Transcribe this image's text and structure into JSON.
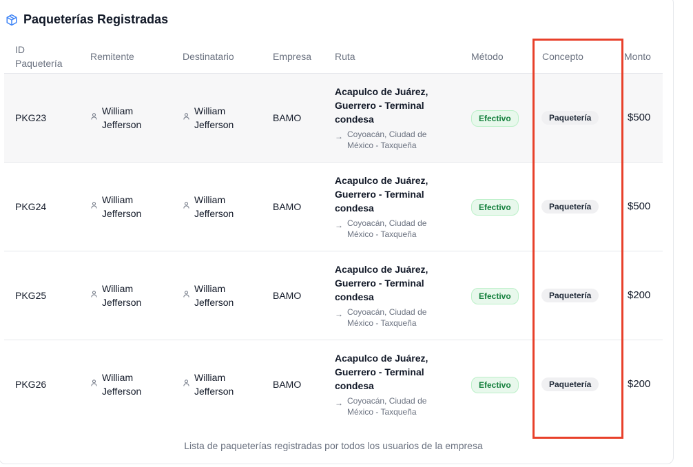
{
  "card": {
    "title": "Paqueterías Registradas",
    "icon": "package-icon",
    "footer": "Lista de paqueterías registradas por todos los usuarios de la empresa"
  },
  "table": {
    "headers": {
      "id_line1": "ID",
      "id_line2": "Paquetería",
      "sender": "Remitente",
      "recipient": "Destinatario",
      "company": "Empresa",
      "route": "Ruta",
      "method": "Método",
      "concept": "Concepto",
      "amount": "Monto"
    },
    "rows": [
      {
        "id": "PKG23",
        "sender_first": "William",
        "sender_last": "Jefferson",
        "recipient_first": "William",
        "recipient_last": "Jefferson",
        "company": "BAMO",
        "origin": "Acapulco de Juárez, Guerrero - Terminal condesa",
        "destination": "Coyoacán, Ciudad de México - Taxqueña",
        "method": "Efectivo",
        "concept": "Paquetería",
        "amount": "$500"
      },
      {
        "id": "PKG24",
        "sender_first": "William",
        "sender_last": "Jefferson",
        "recipient_first": "William",
        "recipient_last": "Jefferson",
        "company": "BAMO",
        "origin": "Acapulco de Juárez, Guerrero - Terminal condesa",
        "destination": "Coyoacán, Ciudad de México - Taxqueña",
        "method": "Efectivo",
        "concept": "Paquetería",
        "amount": "$500"
      },
      {
        "id": "PKG25",
        "sender_first": "William",
        "sender_last": "Jefferson",
        "recipient_first": "William",
        "recipient_last": "Jefferson",
        "company": "BAMO",
        "origin": "Acapulco de Juárez, Guerrero - Terminal condesa",
        "destination": "Coyoacán, Ciudad de México - Taxqueña",
        "method": "Efectivo",
        "concept": "Paquetería",
        "amount": "$200"
      },
      {
        "id": "PKG26",
        "sender_first": "William",
        "sender_last": "Jefferson",
        "recipient_first": "William",
        "recipient_last": "Jefferson",
        "company": "BAMO",
        "origin": "Acapulco de Juárez, Guerrero - Terminal condesa",
        "destination": "Coyoacán, Ciudad de México - Taxqueña",
        "method": "Efectivo",
        "concept": "Paquetería",
        "amount": "$200"
      }
    ]
  },
  "colors": {
    "accent": "#3b82f6",
    "method_badge_text": "#15803d",
    "method_badge_bg": "#e8f8ec",
    "highlight_border": "#e8402a",
    "shaded_row": "#f7f7f8"
  }
}
